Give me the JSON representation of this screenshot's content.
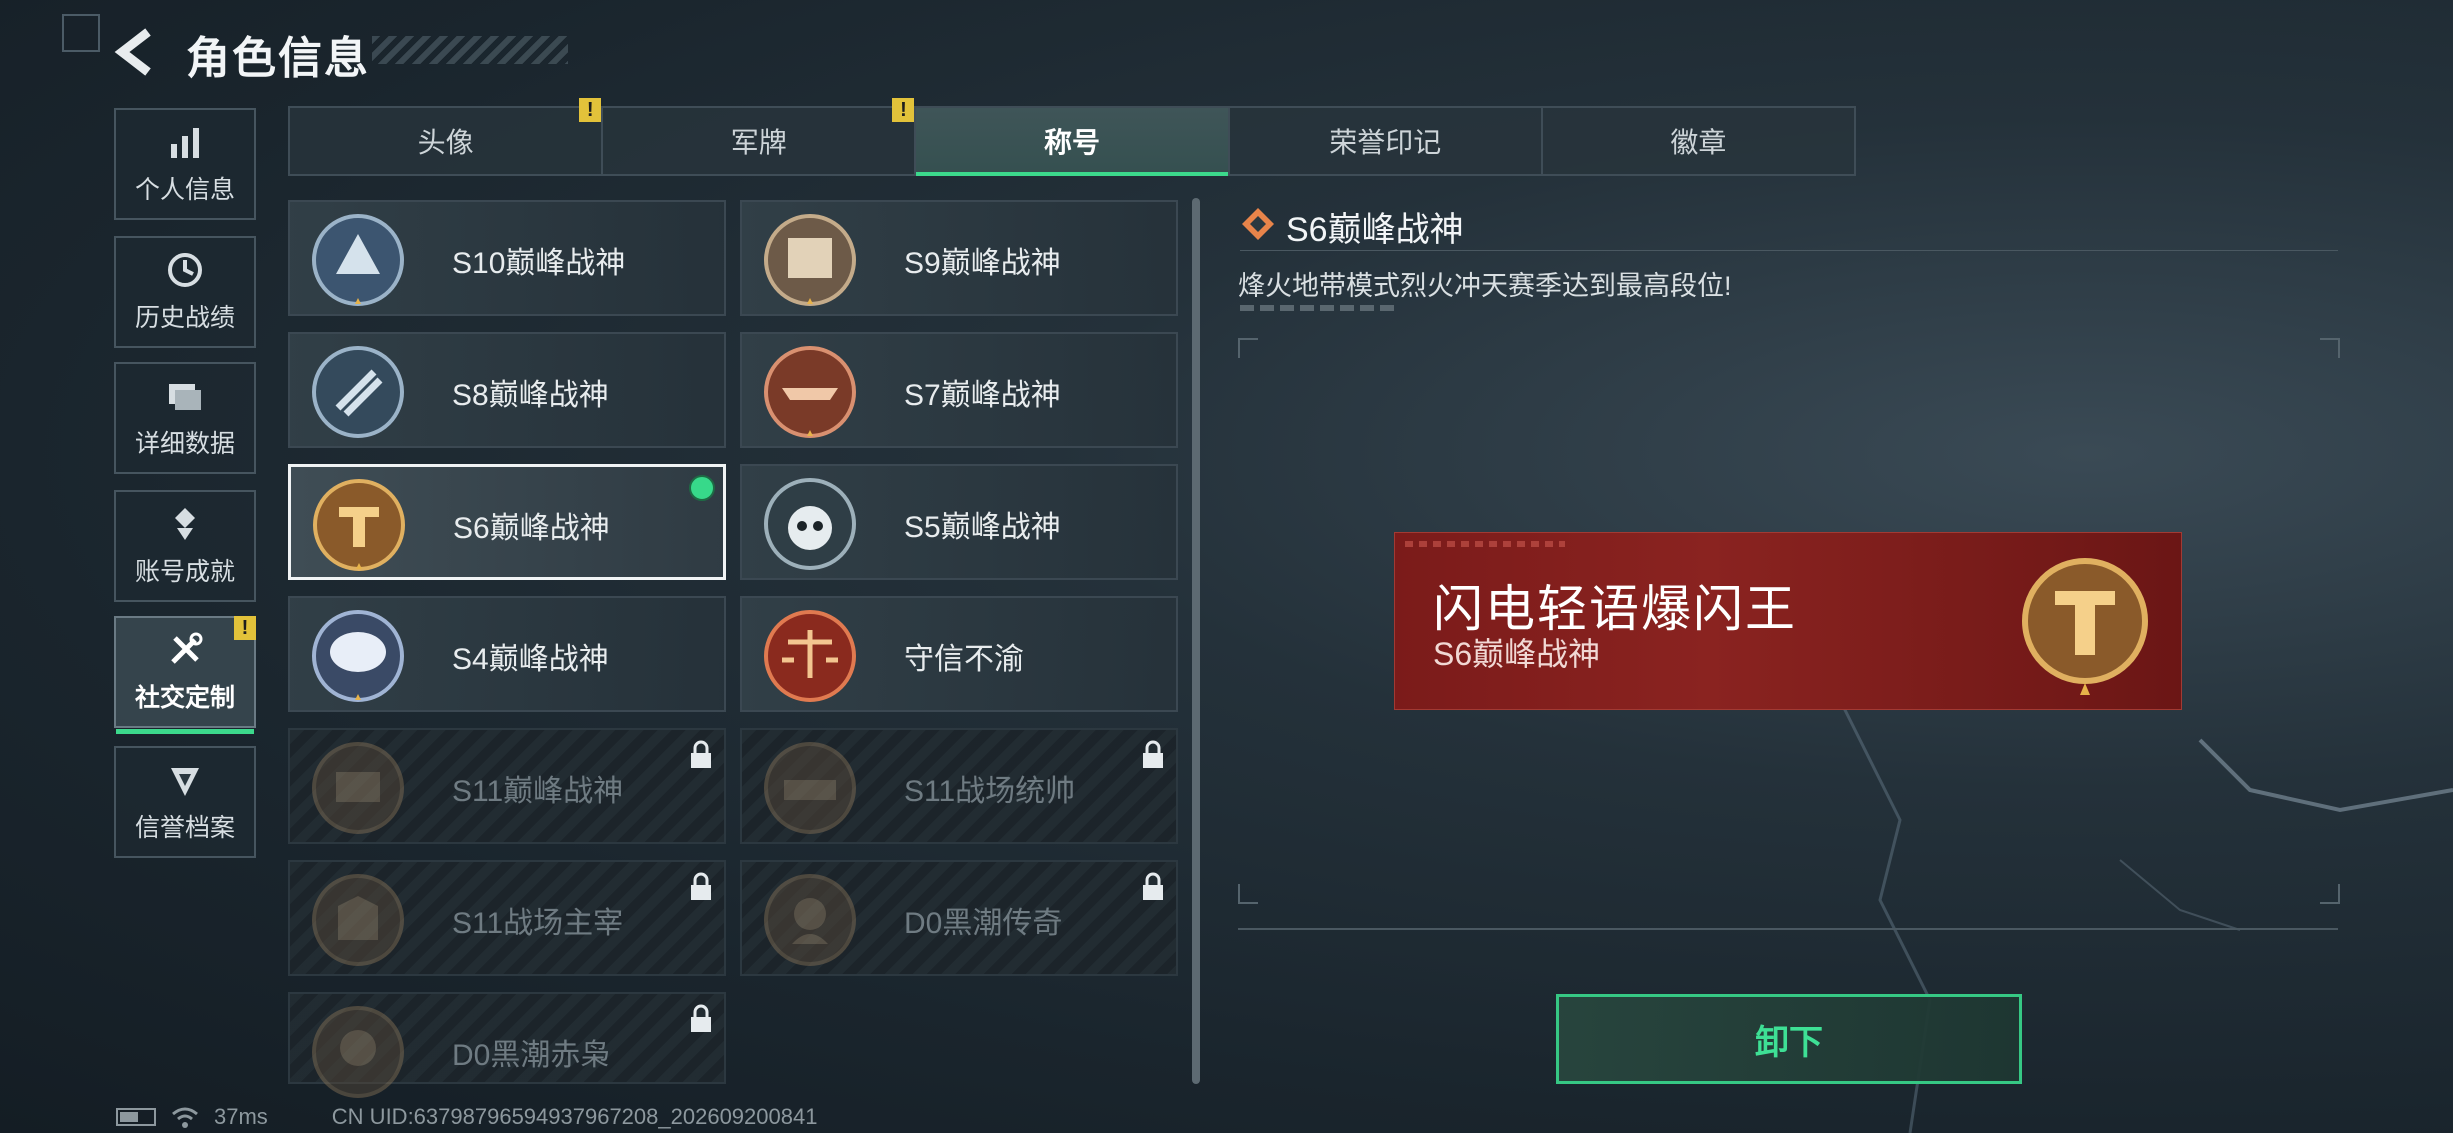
{
  "header": {
    "title": "角色信息"
  },
  "sidebar": {
    "items": [
      {
        "label": "个人信息",
        "icon": "bar-chart-icon"
      },
      {
        "label": "历史战绩",
        "icon": "clock-icon"
      },
      {
        "label": "详细数据",
        "icon": "folder-icon"
      },
      {
        "label": "账号成就",
        "icon": "achievement-icon"
      },
      {
        "label": "社交定制",
        "icon": "tools-icon",
        "active": true,
        "warning": "!"
      },
      {
        "label": "信誉档案",
        "icon": "credit-icon"
      }
    ]
  },
  "tabs": [
    {
      "label": "头像",
      "warning": "!"
    },
    {
      "label": "军牌",
      "warning": "!"
    },
    {
      "label": "称号",
      "active": true
    },
    {
      "label": "荣誉印记"
    },
    {
      "label": "徽章"
    }
  ],
  "titles": [
    {
      "name": "S10巅峰战神",
      "locked": false
    },
    {
      "name": "S9巅峰战神",
      "locked": false
    },
    {
      "name": "S8巅峰战神",
      "locked": false
    },
    {
      "name": "S7巅峰战神",
      "locked": false
    },
    {
      "name": "S6巅峰战神",
      "locked": false,
      "selected": true,
      "equipped": true
    },
    {
      "name": "S5巅峰战神",
      "locked": false
    },
    {
      "name": "S4巅峰战神",
      "locked": false
    },
    {
      "name": "守信不渝",
      "locked": false
    },
    {
      "name": "S11巅峰战神",
      "locked": true
    },
    {
      "name": "S11战场统帅",
      "locked": true
    },
    {
      "name": "S11战场主宰",
      "locked": true
    },
    {
      "name": "D0黑潮传奇",
      "locked": true
    },
    {
      "name": "D0黑潮赤枭",
      "locked": true
    }
  ],
  "detail": {
    "title": "S6巅峰战神",
    "description": "烽火地带模式烈火冲天赛季达到最高段位!",
    "plate": {
      "title": "闪电轻语爆闪王",
      "subtitle": "S6巅峰战神"
    },
    "unequip_label": "卸下"
  },
  "footer": {
    "ping": "37ms",
    "uid": "CN UID:6379879659493796720​8_202609200841"
  },
  "colors": {
    "accent": "#3cd98c",
    "warning": "#e2c23a",
    "plate": "#8a2320"
  }
}
